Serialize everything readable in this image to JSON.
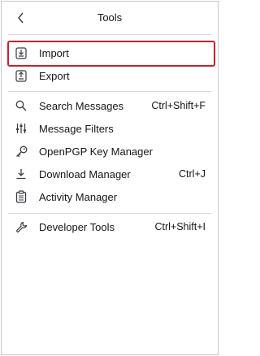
{
  "header": {
    "title": "Tools"
  },
  "items": [
    {
      "label": "Import",
      "shortcut": "",
      "icon": "import-icon"
    },
    {
      "label": "Export",
      "shortcut": "",
      "icon": "export-icon"
    },
    {
      "label": "Search Messages",
      "shortcut": "Ctrl+Shift+F",
      "icon": "search-icon"
    },
    {
      "label": "Message Filters",
      "shortcut": "",
      "icon": "filters-icon"
    },
    {
      "label": "OpenPGP Key Manager",
      "shortcut": "",
      "icon": "key-icon"
    },
    {
      "label": "Download Manager",
      "shortcut": "Ctrl+J",
      "icon": "download-icon"
    },
    {
      "label": "Activity Manager",
      "shortcut": "",
      "icon": "activity-icon"
    },
    {
      "label": "Developer Tools",
      "shortcut": "Ctrl+Shift+I",
      "icon": "wrench-icon"
    }
  ],
  "colors": {
    "highlight": "#cc2030",
    "text": "#15141a",
    "separator": "#d8d8dc"
  }
}
